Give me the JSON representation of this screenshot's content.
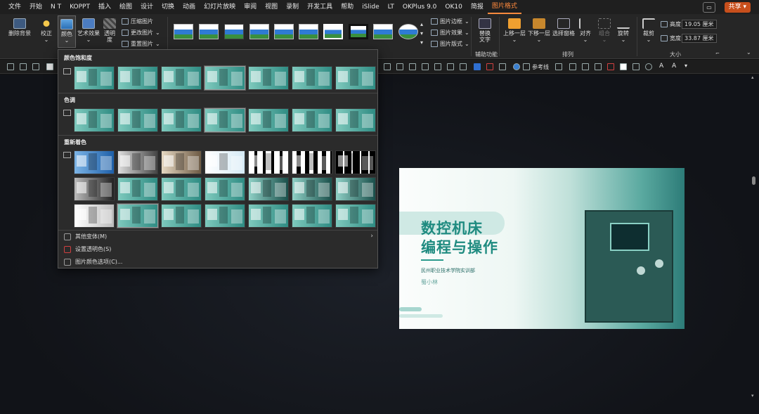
{
  "menu": [
    "文件",
    "开始",
    "N T",
    "KOPPT",
    "插入",
    "绘图",
    "设计",
    "切换",
    "动画",
    "幻灯片放映",
    "审阅",
    "视图",
    "录制",
    "开发工具",
    "帮助",
    "iSlide",
    "LT",
    "OKPlus 9.0",
    "OK10",
    "简报",
    "图片格式"
  ],
  "menu_active_index": 20,
  "share_label": "共享",
  "ribbon": {
    "remove_bg": "删除背景",
    "correct": "校正",
    "color": "颜色",
    "artistic": "艺术效果",
    "transparency_1": "透明",
    "transparency_2": "度",
    "compress": "压缩图片",
    "change_pic": "更改图片",
    "reset_pic": "重置图片",
    "pic_border": "图片边框",
    "pic_effect": "图片效果",
    "pic_layout": "图片版式",
    "alt_text_1": "替换",
    "alt_text_2": "文字",
    "accessibility": "辅助功能",
    "bring_forward": "上移一层",
    "send_backward": "下移一层",
    "select_pane": "选择窗格",
    "align": "对齐",
    "group": "组合",
    "rotate": "旋转",
    "arrange": "排列",
    "crop": "裁剪",
    "height_label": "高度:",
    "height_value": "19.05 厘米",
    "width_label": "宽度:",
    "width_value": "33.87 厘米",
    "size": "大小"
  },
  "toolbar2": {
    "guides": "参考线"
  },
  "dropdown": {
    "section_saturation": "颜色饱和度",
    "section_tone": "色调",
    "section_recolor": "重新着色",
    "more_variants": "其他变体(M)",
    "set_transparent": "设置透明色(S)",
    "color_options": "图片颜色选项(C)..."
  },
  "slide": {
    "title_line1": "数控机床",
    "title_line2": "编程与操作",
    "org": "民州职业技术学院实训部",
    "author": "蜀小林"
  },
  "colors": {
    "accent": "#ff8a3d",
    "teal": "#1f8b80",
    "bg": "#121212"
  }
}
